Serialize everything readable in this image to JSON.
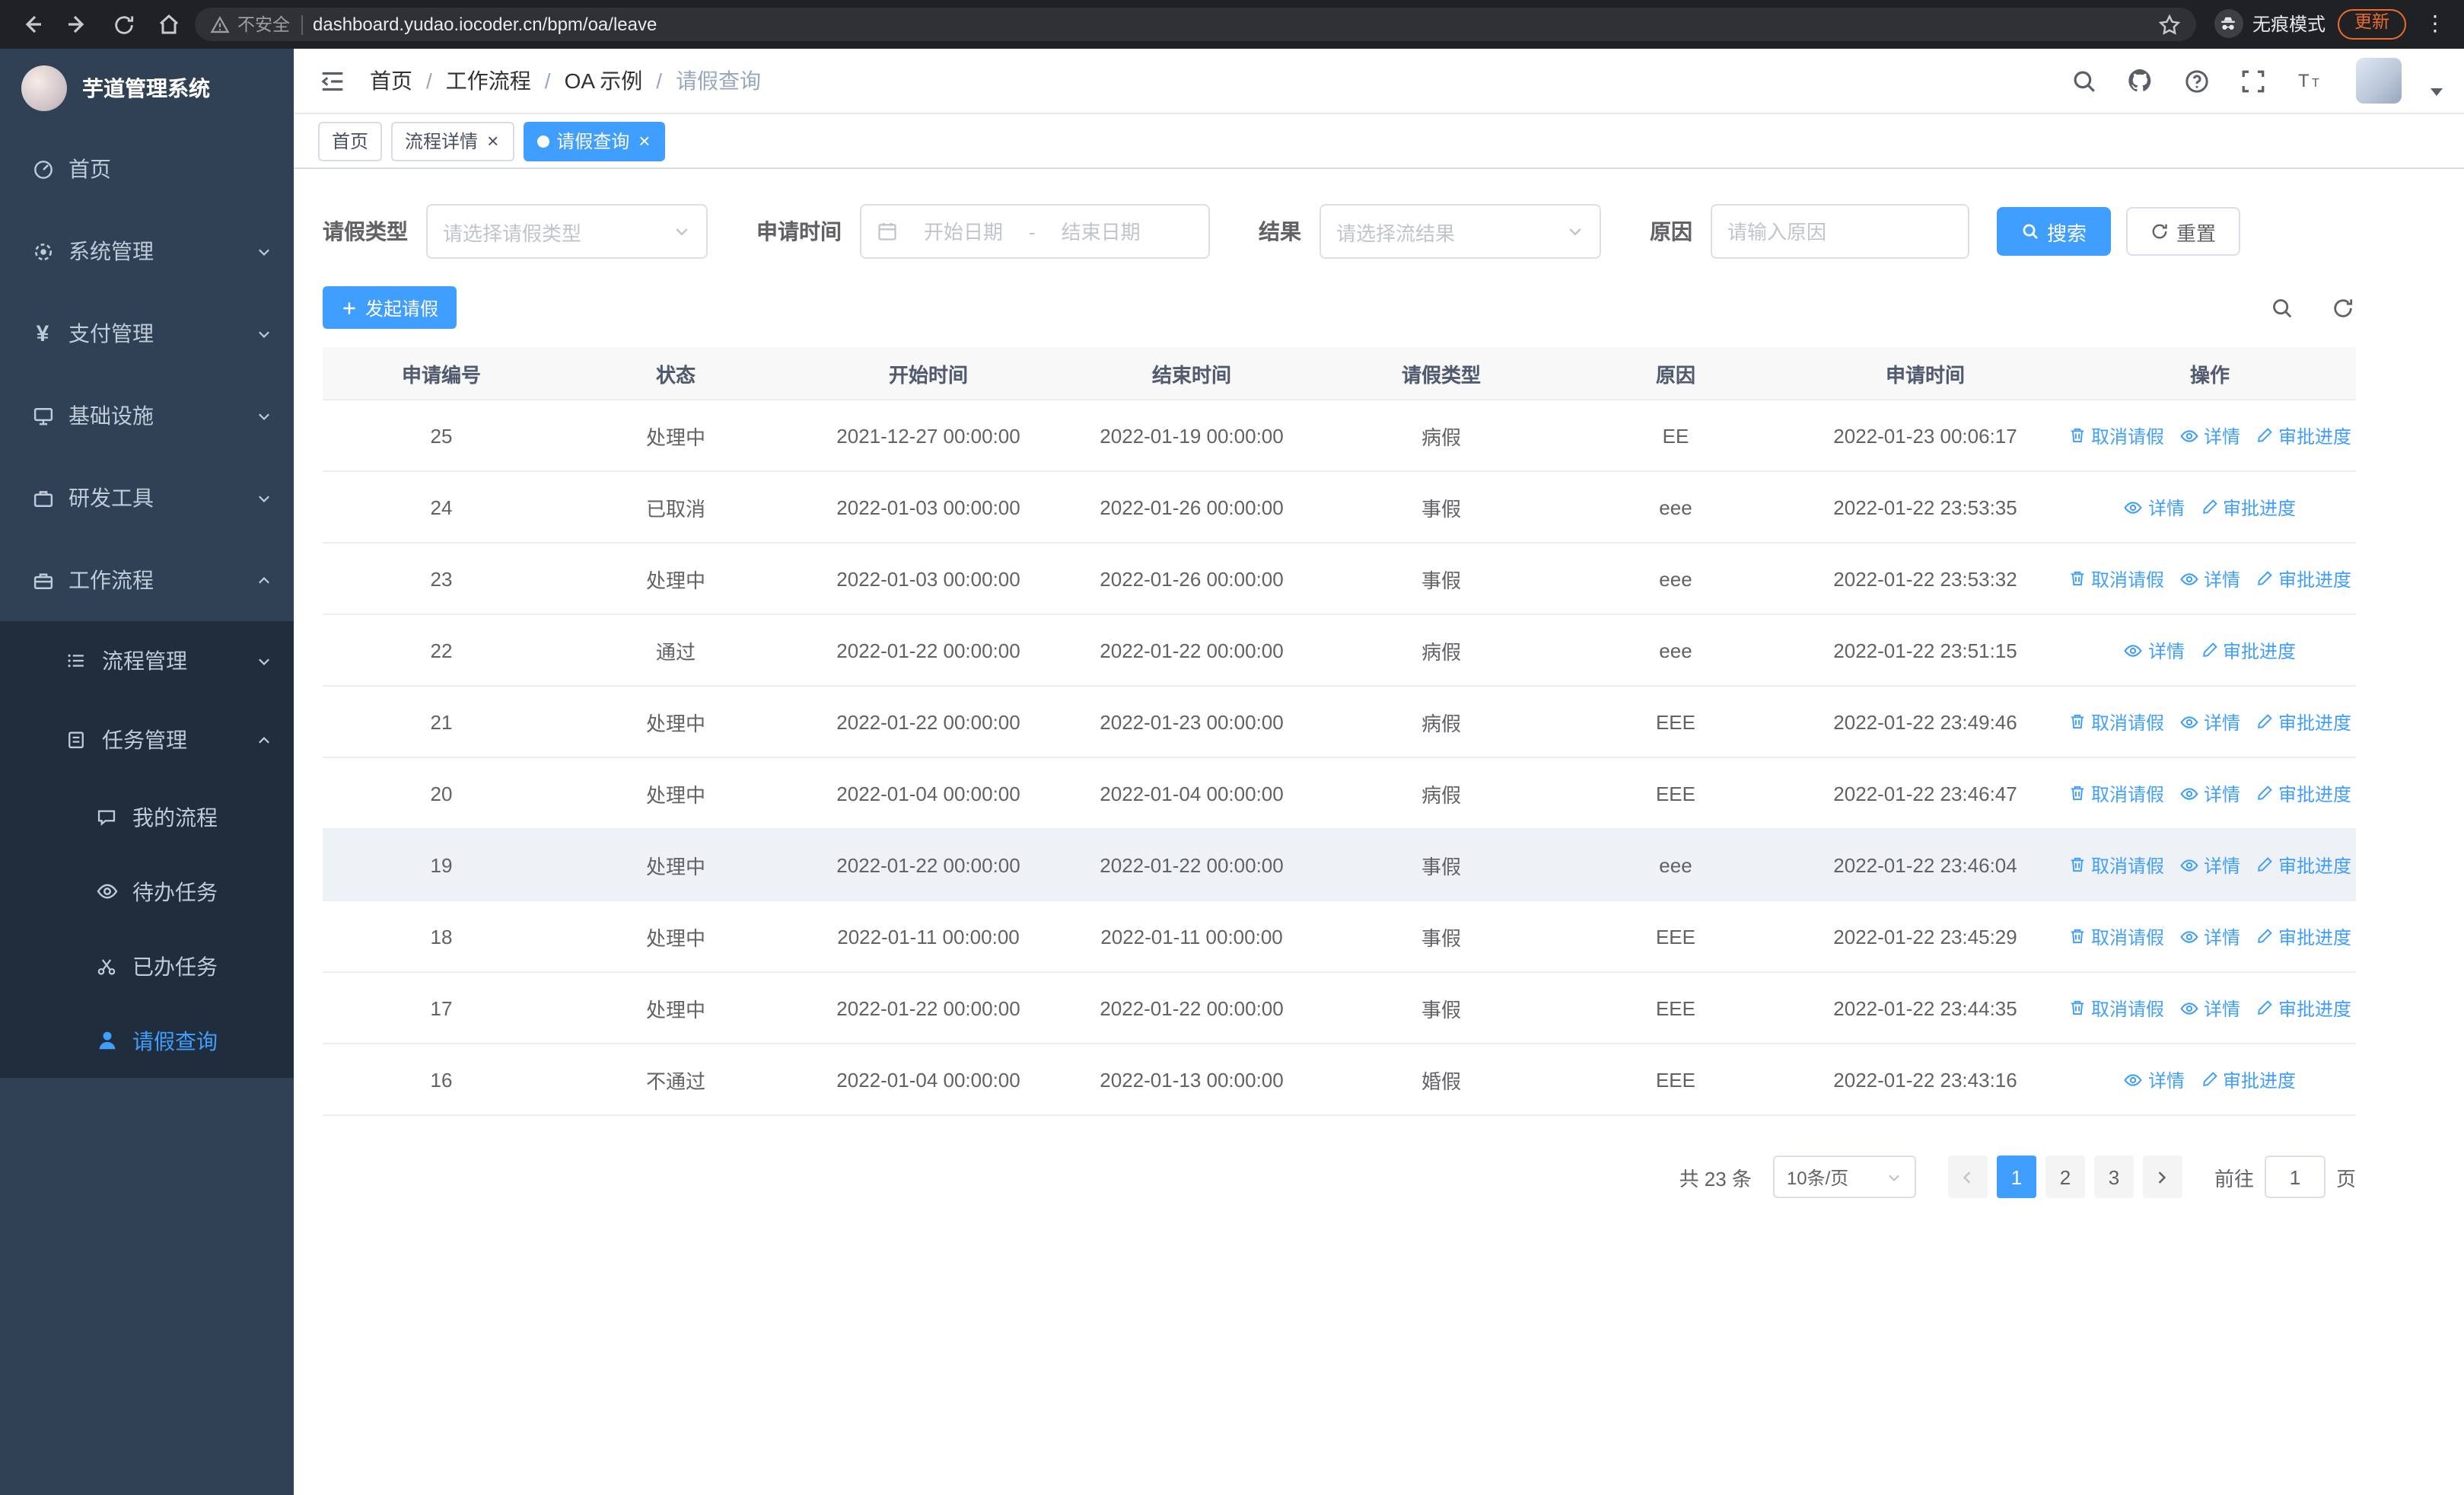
{
  "theme": {
    "accent": "#409EFF",
    "sidebar_bg": "#304156",
    "sidebar_submenu_bg": "#1f2d3d",
    "sidebar_text": "#bfcbd9",
    "browser_bar_bg": "#202124",
    "update_color": "#ed6c2d",
    "row_hover_bg": "#eef1f6"
  },
  "browser": {
    "security_label": "不安全",
    "url": "dashboard.yudao.iocoder.cn/bpm/oa/leave",
    "incognito_label": "无痕模式",
    "update_label": "更新"
  },
  "sidebar": {
    "logo_title": "芋道管理系统",
    "items": [
      {
        "label": "首页"
      },
      {
        "label": "系统管理"
      },
      {
        "label": "支付管理"
      },
      {
        "label": "基础设施"
      },
      {
        "label": "研发工具"
      },
      {
        "label": "工作流程"
      }
    ],
    "workflow_children": [
      {
        "label": "流程管理"
      },
      {
        "label": "任务管理"
      }
    ],
    "task_children": [
      {
        "label": "我的流程"
      },
      {
        "label": "待办任务"
      },
      {
        "label": "已办任务"
      },
      {
        "label": "请假查询"
      }
    ]
  },
  "header": {
    "breadcrumb": [
      "首页",
      "工作流程",
      "OA 示例",
      "请假查询"
    ]
  },
  "tabs": [
    {
      "label": "首页"
    },
    {
      "label": "流程详情"
    },
    {
      "label": "请假查询"
    }
  ],
  "filters": {
    "leave_type_label": "请假类型",
    "leave_type_placeholder": "请选择请假类型",
    "apply_time_label": "申请时间",
    "start_date_placeholder": "开始日期",
    "range_separator": "-",
    "end_date_placeholder": "结束日期",
    "result_label": "结果",
    "result_placeholder": "请选择流结果",
    "reason_label": "原因",
    "reason_placeholder": "请输入原因",
    "search_button": "搜索",
    "reset_button": "重置"
  },
  "toolbar": {
    "create_button": "发起请假"
  },
  "table": {
    "columns": [
      "申请编号",
      "状态",
      "开始时间",
      "结束时间",
      "请假类型",
      "原因",
      "申请时间",
      "操作"
    ],
    "action_labels": {
      "cancel": "取消请假",
      "detail": "详情",
      "progress": "审批进度"
    },
    "rows": [
      {
        "id": "25",
        "status": "处理中",
        "start": "2021-12-27 00:00:00",
        "end": "2022-01-19 00:00:00",
        "type": "病假",
        "reason": "EE",
        "applied": "2022-01-23 00:06:17",
        "cancellable": true,
        "highlighted": false
      },
      {
        "id": "24",
        "status": "已取消",
        "start": "2022-01-03 00:00:00",
        "end": "2022-01-26 00:00:00",
        "type": "事假",
        "reason": "eee",
        "applied": "2022-01-22 23:53:35",
        "cancellable": false,
        "highlighted": false
      },
      {
        "id": "23",
        "status": "处理中",
        "start": "2022-01-03 00:00:00",
        "end": "2022-01-26 00:00:00",
        "type": "事假",
        "reason": "eee",
        "applied": "2022-01-22 23:53:32",
        "cancellable": true,
        "highlighted": false
      },
      {
        "id": "22",
        "status": "通过",
        "start": "2022-01-22 00:00:00",
        "end": "2022-01-22 00:00:00",
        "type": "病假",
        "reason": "eee",
        "applied": "2022-01-22 23:51:15",
        "cancellable": false,
        "highlighted": false
      },
      {
        "id": "21",
        "status": "处理中",
        "start": "2022-01-22 00:00:00",
        "end": "2022-01-23 00:00:00",
        "type": "病假",
        "reason": "EEE",
        "applied": "2022-01-22 23:49:46",
        "cancellable": true,
        "highlighted": false
      },
      {
        "id": "20",
        "status": "处理中",
        "start": "2022-01-04 00:00:00",
        "end": "2022-01-04 00:00:00",
        "type": "病假",
        "reason": "EEE",
        "applied": "2022-01-22 23:46:47",
        "cancellable": true,
        "highlighted": false
      },
      {
        "id": "19",
        "status": "处理中",
        "start": "2022-01-22 00:00:00",
        "end": "2022-01-22 00:00:00",
        "type": "事假",
        "reason": "eee",
        "applied": "2022-01-22 23:46:04",
        "cancellable": true,
        "highlighted": true
      },
      {
        "id": "18",
        "status": "处理中",
        "start": "2022-01-11 00:00:00",
        "end": "2022-01-11 00:00:00",
        "type": "事假",
        "reason": "EEE",
        "applied": "2022-01-22 23:45:29",
        "cancellable": true,
        "highlighted": false
      },
      {
        "id": "17",
        "status": "处理中",
        "start": "2022-01-22 00:00:00",
        "end": "2022-01-22 00:00:00",
        "type": "事假",
        "reason": "EEE",
        "applied": "2022-01-22 23:44:35",
        "cancellable": true,
        "highlighted": false
      },
      {
        "id": "16",
        "status": "不通过",
        "start": "2022-01-04 00:00:00",
        "end": "2022-01-13 00:00:00",
        "type": "婚假",
        "reason": "EEE",
        "applied": "2022-01-22 23:43:16",
        "cancellable": false,
        "highlighted": false
      }
    ]
  },
  "pagination": {
    "total_label": "共 23 条",
    "page_size_label": "10条/页",
    "pages": [
      "1",
      "2",
      "3"
    ],
    "active_page": "1",
    "goto_label": "前往",
    "goto_value": "1",
    "page_unit": "页"
  }
}
